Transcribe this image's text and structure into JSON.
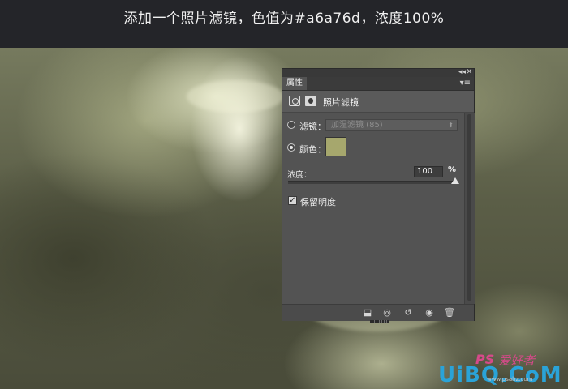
{
  "caption": "添加一个照片滤镜，色值为#a6a76d，浓度100%",
  "panel": {
    "collapse_glyph": "◂◂",
    "close_glyph": "✕",
    "tab_label": "属性",
    "menu_glyph": "▾≡",
    "title": "照片滤镜",
    "filter": {
      "label": "滤镜：",
      "value": "加温滤镜 (85)",
      "selected": false
    },
    "color": {
      "label": "颜色：",
      "value": "#a6a76d",
      "selected": true
    },
    "density": {
      "label": "浓度：",
      "value": "100",
      "unit": "%",
      "level": 1.0
    },
    "preserve": {
      "label": "保留明度",
      "checked": true,
      "mark": "✓"
    },
    "bottom_icons": [
      {
        "name": "clip-to-layer-icon",
        "glyph": "⬓"
      },
      {
        "name": "view-previous-icon",
        "glyph": "◎"
      },
      {
        "name": "reset-icon",
        "glyph": "↺"
      },
      {
        "name": "visibility-eye-icon",
        "glyph": "◉"
      },
      {
        "name": "trash-icon",
        "glyph": "🗑"
      }
    ]
  },
  "watermark": {
    "ps_text": "PS",
    "hand_text": "爱好者",
    "brand": "UiBQ.CoM",
    "url": "www.psahz.com"
  }
}
